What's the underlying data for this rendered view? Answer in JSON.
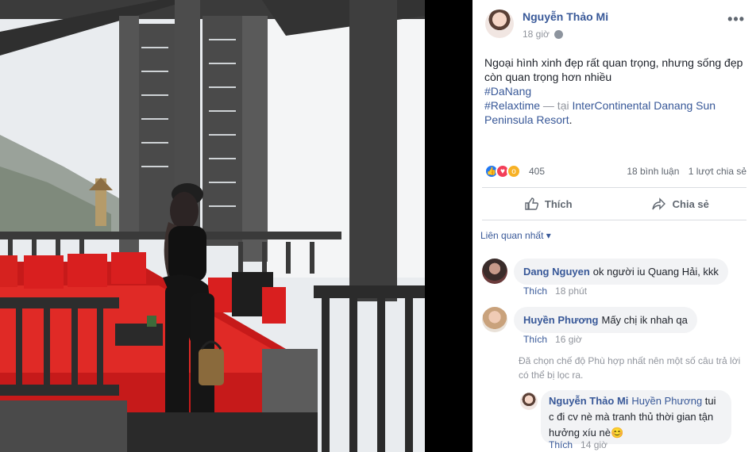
{
  "post": {
    "author": "Nguyễn Thảo Mi",
    "time": "18 giờ",
    "text_line": "Ngoại hình xinh đẹp rất quan trọng, nhưng sống đẹp còn quan trọng hơn nhiều",
    "hashtag1": "#DaNang",
    "hashtag2": "#Relaxtime",
    "at_separator": " — tại ",
    "location": "InterContinental Danang Sun Peninsula Resort",
    "location_end": "."
  },
  "icons": {
    "more": "more-options-icon",
    "privacy": "globe-icon",
    "like": "like-icon",
    "share": "share-icon"
  },
  "reactions": {
    "count": "405",
    "comments": "18 bình luận",
    "shares": "1 lượt chia sẻ"
  },
  "actions": {
    "like_label": "Thích",
    "share_label": "Chia sẻ"
  },
  "sort_label": "Liên quan nhất",
  "comments": [
    {
      "name": "Dang Nguyen",
      "text": "ok người iu Quang Hải, kkk",
      "like_label": "Thích",
      "time": "18 phút"
    },
    {
      "name": "Huyền Phương",
      "text": "Mấy chị ik nhah qa",
      "like_label": "Thích",
      "time": "16 giờ"
    }
  ],
  "filter_note": "Đã chọn chế độ Phù hợp nhất nên một số câu trả lời có thể bị lọc ra.",
  "reply": {
    "name": "Nguyễn Thảo Mi",
    "mention": "Huyền Phương",
    "text_line1": "tui",
    "text_line2": "c đi cv nè mà tranh thủ thời gian tận",
    "text_line3": "hưởng xíu nè😊",
    "like_label": "Thích",
    "time": "14 giờ"
  },
  "colors": {
    "link": "#385898",
    "like_blue": "#2078f4",
    "love_red": "#f33e58",
    "wow_yellow": "#f7b125"
  }
}
